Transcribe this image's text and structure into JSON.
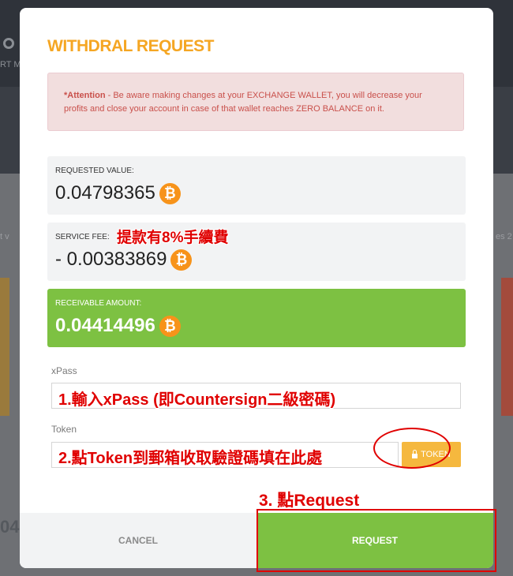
{
  "background": {
    "left_label": "RT M",
    "mid_label": "t v",
    "right_label": "es 2",
    "number": "04"
  },
  "modal": {
    "title": "WITHDRAL REQUEST",
    "alert": {
      "prefix": "*Attention",
      "text": " - Be aware making changes at your EXCHANGE WALLET, you will decrease your profits and close your account in case of that wallet reaches ZERO BALANCE on it."
    },
    "requested": {
      "label": "REQUESTED VALUE:",
      "value": "0.04798365"
    },
    "fee": {
      "label": "SERVICE FEE:",
      "value": "- 0.00383869"
    },
    "receivable": {
      "label": "RECEIVABLE AMOUNT:",
      "value": "0.04414496"
    },
    "xpass": {
      "label": "xPass",
      "value": ""
    },
    "token": {
      "label": "Token",
      "value": "",
      "button_label": "TOKEN"
    },
    "cancel_label": "CANCEL",
    "request_label": "REQUEST",
    "coin_symbol": "₿"
  },
  "annotations": {
    "fee_note": "提款有8%手續費",
    "step1": "1.輸入xPass (即Countersign二級密碼)",
    "step2": "2.點Token到郵箱收取驗證碼填在此處",
    "step3": "3. 點Request"
  },
  "colors": {
    "title": "#f5a623",
    "green": "#7dc142",
    "token_button": "#f5b83e",
    "bitcoin": "#f7931a",
    "annotation": "#e00000"
  }
}
